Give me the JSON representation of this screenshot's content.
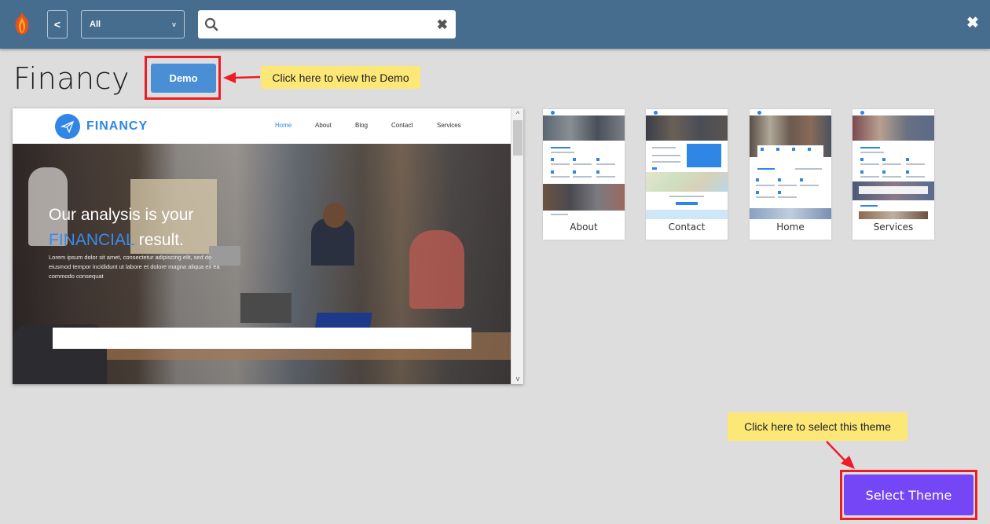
{
  "topbar": {
    "logo_icon": "flame-logo-icon",
    "back_label": "<",
    "filter": {
      "selected": "All",
      "chevron": "v"
    },
    "search": {
      "value": "",
      "placeholder": "",
      "clear_glyph": "✖"
    },
    "close_glyph": "✖"
  },
  "theme": {
    "title": "Financy",
    "demo_label": "Demo",
    "select_label": "Select Theme"
  },
  "annotations": {
    "demo_callout": "Click here to view the Demo",
    "select_callout": "Click here to select this theme",
    "highlight_color": "#ee1c24",
    "callout_color": "#fde877"
  },
  "preview": {
    "brand": "FINANCY",
    "nav": [
      "Home",
      "About",
      "Blog",
      "Contact",
      "Services"
    ],
    "active_nav": "Home",
    "hero_line1": "Our analysis is your",
    "hero_accent": "FINANCIAL",
    "hero_line2_rest": " result.",
    "hero_paragraph": "Lorem ipsum dolor sit amet, consectetur adipiscing elit, sed do eiusmod tempor incididunt ut labore et dolore magna aliqua ex ea commodo consequat",
    "scroll_up": "^",
    "scroll_down": "v"
  },
  "pages": [
    {
      "label": "About"
    },
    {
      "label": "Contact"
    },
    {
      "label": "Home"
    },
    {
      "label": "Services"
    }
  ],
  "colors": {
    "topbar": "#466c8e",
    "demo_button": "#4a8fd6",
    "select_button": "#7446f5",
    "brand_blue": "#2f86e5"
  }
}
